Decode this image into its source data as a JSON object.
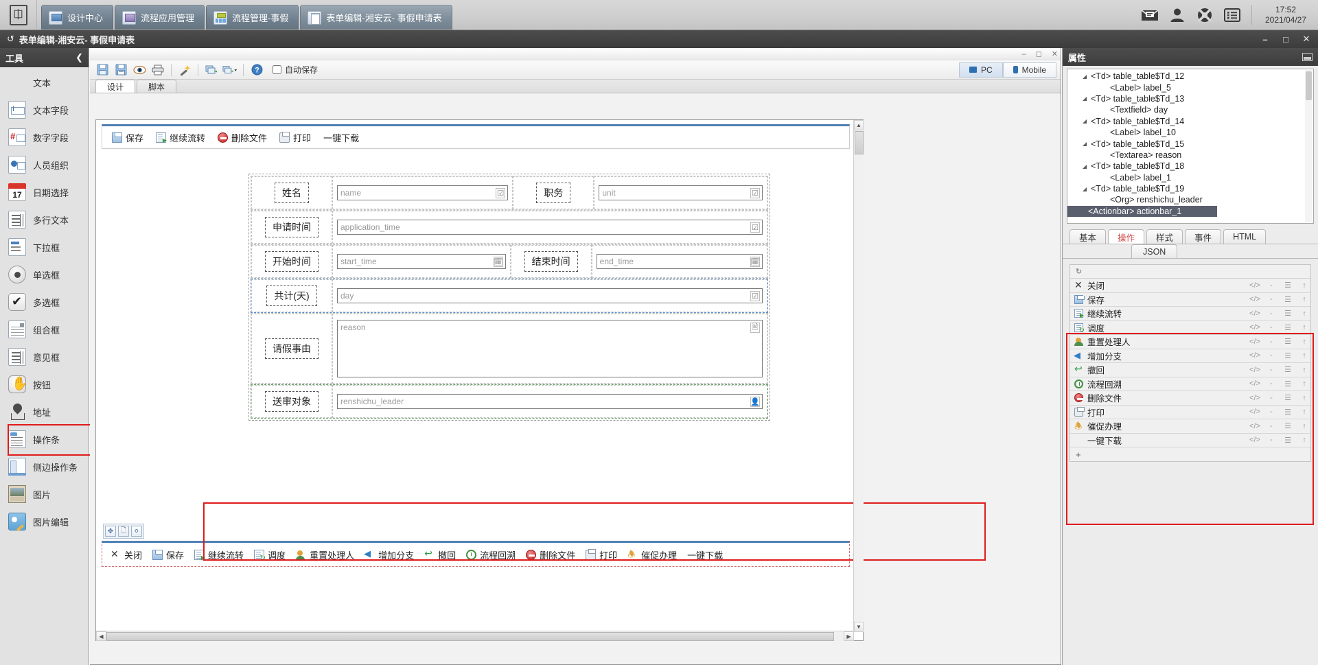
{
  "topbar": {
    "logo_icon": "app-logo-icon",
    "tabs": [
      {
        "label": "设计中心",
        "icon": "design-center-icon",
        "active": false
      },
      {
        "label": "流程应用管理",
        "icon": "flow-app-management-icon",
        "active": false
      },
      {
        "label": "流程管理-事假",
        "icon": "flow-management-icon",
        "active": false
      },
      {
        "label": "表单编辑-湘安云- 事假申请表",
        "icon": "form-editor-icon",
        "active": true
      }
    ],
    "icons": [
      "mail-icon",
      "user-icon",
      "support-icon",
      "list-icon"
    ],
    "time": "17:52",
    "date": "2021/04/27"
  },
  "window": {
    "title": "表单编辑-湘安云- 事假申请表",
    "refresh_icon": "refresh-icon",
    "minimize": "–",
    "maximize": "□",
    "close": "✕"
  },
  "sidebar": {
    "title": "工具",
    "collapse_icon": "❮",
    "items": [
      {
        "label": "文本",
        "icon": "text-icon",
        "shape": "ic-text"
      },
      {
        "label": "文本字段",
        "icon": "textfield-icon",
        "shape": "ic-box ic-textfield"
      },
      {
        "label": "数字字段",
        "icon": "number-field-icon",
        "shape": "ic-box ic-num"
      },
      {
        "label": "人员组织",
        "icon": "org-person-icon",
        "shape": "ic-box ic-org"
      },
      {
        "label": "日期选择",
        "icon": "date-picker-icon",
        "shape": "ic-date"
      },
      {
        "label": "多行文本",
        "icon": "multiline-text-icon",
        "shape": "ic-box ic-lines"
      },
      {
        "label": "下拉框",
        "icon": "dropdown-icon",
        "shape": "ic-box ic-select"
      },
      {
        "label": "单选框",
        "icon": "radio-button-icon",
        "shape": "ic-radio"
      },
      {
        "label": "多选框",
        "icon": "checkbox-icon",
        "shape": "ic-check"
      },
      {
        "label": "组合框",
        "icon": "combobox-icon",
        "shape": "ic-box ic-combo"
      },
      {
        "label": "意见框",
        "icon": "opinion-box-icon",
        "shape": "ic-box ic-lines"
      },
      {
        "label": "按钮",
        "icon": "button-icon",
        "shape": "ic-button"
      },
      {
        "label": "地址",
        "icon": "address-pin-icon",
        "shape": "ic-addr"
      },
      {
        "label": "操作条",
        "icon": "actionbar-icon",
        "shape": "ic-box ic-actionbar",
        "highlighted": true
      },
      {
        "label": "侧边操作条",
        "icon": "side-actionbar-icon",
        "shape": "ic-box ic-sideaction"
      },
      {
        "label": "图片",
        "icon": "image-icon",
        "shape": "ic-image"
      },
      {
        "label": "图片编辑",
        "icon": "image-edit-icon",
        "shape": "ic-imgedit"
      }
    ]
  },
  "editor": {
    "toolbar_icons": [
      "save-icon",
      "save-as-icon",
      "preview-eye-icon",
      "print-icon",
      "magic-wand-icon",
      "import-icon",
      "export-dropdown-icon",
      "help-icon"
    ],
    "autosave_label": "自动保存",
    "autosave_checked": false,
    "device_pc": "PC",
    "device_mobile": "Mobile",
    "device_selected": "PC",
    "tabs": [
      {
        "label": "设计",
        "active": true
      },
      {
        "label": "脚本",
        "active": false
      }
    ],
    "top_actionbar": [
      {
        "label": "保存",
        "icon": "save-icon",
        "shape": "ai-save"
      },
      {
        "label": "继续流转",
        "icon": "continue-flow-icon",
        "shape": "ai-flow"
      },
      {
        "label": "删除文件",
        "icon": "delete-file-icon",
        "shape": "ai-del"
      },
      {
        "label": "打印",
        "icon": "print-icon",
        "shape": "ai-print"
      },
      {
        "label": "一键下载",
        "icon": "none",
        "shape": "ai-none"
      }
    ],
    "bottom_actionbar": [
      {
        "label": "关闭",
        "icon": "close-icon",
        "shape": "ai-close"
      },
      {
        "label": "保存",
        "icon": "save-icon",
        "shape": "ai-save"
      },
      {
        "label": "继续流转",
        "icon": "continue-flow-icon",
        "shape": "ai-flow"
      },
      {
        "label": "调度",
        "icon": "dispatch-icon",
        "shape": "ai-dispatch"
      },
      {
        "label": "重置处理人",
        "icon": "reset-handler-icon",
        "shape": "ai-reset"
      },
      {
        "label": "增加分支",
        "icon": "add-branch-icon",
        "shape": "ai-branch"
      },
      {
        "label": "撤回",
        "icon": "withdraw-icon",
        "shape": "ai-undo"
      },
      {
        "label": "流程回溯",
        "icon": "flow-trace-icon",
        "shape": "ai-trace"
      },
      {
        "label": "删除文件",
        "icon": "delete-file-icon",
        "shape": "ai-del"
      },
      {
        "label": "打印",
        "icon": "print-icon",
        "shape": "ai-print"
      },
      {
        "label": "催促办理",
        "icon": "urge-icon",
        "shape": "ai-urge"
      },
      {
        "label": "一键下载",
        "icon": "none",
        "shape": "ai-none"
      }
    ],
    "form_rows": [
      {
        "cells": [
          {
            "label": "姓名",
            "value": "name",
            "field_icon": "select-field-icon",
            "width": "flex"
          },
          {
            "label": "职务",
            "value": "unit",
            "field_icon": "select-field-icon",
            "width": "flex"
          }
        ]
      },
      {
        "cells": [
          {
            "label": "申请时间",
            "value": "application_time",
            "field_icon": "select-field-icon",
            "width": "full"
          }
        ]
      },
      {
        "cells": [
          {
            "label": "开始时间",
            "value": "start_time",
            "field_icon": "calendar-icon",
            "width": "flex"
          },
          {
            "label": "结束时间",
            "value": "end_time",
            "field_icon": "calendar-icon",
            "width": "flex"
          }
        ]
      },
      {
        "selected": true,
        "cells": [
          {
            "label": "共计(天)",
            "value": "day",
            "field_icon": "select-field-icon",
            "width": "full"
          }
        ]
      },
      {
        "tall": true,
        "cells": [
          {
            "label": "请假事由",
            "value": "reason",
            "field_icon": "textarea-icon",
            "width": "full"
          }
        ]
      },
      {
        "green": true,
        "cells": [
          {
            "label": "送审对象",
            "value": "renshichu_leader",
            "field_icon": "person-picker-icon",
            "width": "full"
          }
        ]
      }
    ],
    "widget_handles": [
      "move-handle-icon",
      "copy-handle-icon",
      "delete-handle-icon"
    ]
  },
  "properties": {
    "title": "属性",
    "minimize_icon": "minimize-icon",
    "tree": [
      {
        "text": "<Td> table_table$Td_12",
        "level": 0,
        "expander": true
      },
      {
        "text": "<Label> label_5",
        "level": 1,
        "expander": false
      },
      {
        "text": "<Td> table_table$Td_13",
        "level": 0,
        "expander": true
      },
      {
        "text": "<Textfield> day",
        "level": 1,
        "expander": false
      },
      {
        "text": "<Td> table_table$Td_14",
        "level": 0,
        "expander": true
      },
      {
        "text": "<Label> label_10",
        "level": 1,
        "expander": false
      },
      {
        "text": "<Td> table_table$Td_15",
        "level": 0,
        "expander": true
      },
      {
        "text": "<Textarea> reason",
        "level": 1,
        "expander": false
      },
      {
        "text": "<Td> table_table$Td_18",
        "level": 0,
        "expander": true
      },
      {
        "text": "<Label> label_1",
        "level": 1,
        "expander": false
      },
      {
        "text": "<Td> table_table$Td_19",
        "level": 0,
        "expander": true
      },
      {
        "text": "<Org> renshichu_leader",
        "level": 1,
        "expander": false
      },
      {
        "text": "<Actionbar> actionbar_1",
        "level": 0,
        "expander": false,
        "selected": true
      }
    ],
    "tabs": [
      {
        "label": "基本",
        "active": false
      },
      {
        "label": "操作",
        "active": true
      },
      {
        "label": "样式",
        "active": false
      },
      {
        "label": "事件",
        "active": false
      },
      {
        "label": "HTML",
        "active": false
      }
    ],
    "subtabs": [
      {
        "label": "JSON",
        "active": false
      }
    ],
    "list_toolbar_icon": "history-icon",
    "action_items": [
      {
        "label": "关闭",
        "icon": "close-icon",
        "shape": "ai-close",
        "code": "</>",
        "dash": "-",
        "menu": "menu-icon",
        "up": "↑"
      },
      {
        "label": "保存",
        "icon": "save-icon",
        "shape": "ai-save",
        "code": "</>",
        "dash": "-",
        "menu": "menu-icon",
        "up": "↑"
      },
      {
        "label": "继续流转",
        "icon": "continue-flow-icon",
        "shape": "ai-flow",
        "code": "</>",
        "dash": "-",
        "menu": "menu-icon",
        "up": "↑"
      },
      {
        "label": "调度",
        "icon": "dispatch-icon",
        "shape": "ai-dispatch",
        "code": "</>",
        "dash": "-",
        "menu": "menu-icon",
        "up": "↑"
      },
      {
        "label": "重置处理人",
        "icon": "reset-handler-icon",
        "shape": "ai-reset",
        "code": "</>",
        "dash": "-",
        "menu": "menu-icon",
        "up": "↑"
      },
      {
        "label": "增加分支",
        "icon": "add-branch-icon",
        "shape": "ai-branch",
        "code": "</>",
        "dash": "-",
        "menu": "menu-icon",
        "up": "↑"
      },
      {
        "label": "撤回",
        "icon": "withdraw-icon",
        "shape": "ai-undo",
        "code": "</>",
        "dash": "-",
        "menu": "menu-icon",
        "up": "↑"
      },
      {
        "label": "流程回溯",
        "icon": "flow-trace-icon",
        "shape": "ai-trace",
        "code": "</>",
        "dash": "-",
        "menu": "menu-icon",
        "up": "↑"
      },
      {
        "label": "删除文件",
        "icon": "delete-file-icon",
        "shape": "ai-del",
        "code": "</>",
        "dash": "-",
        "menu": "menu-icon",
        "up": "↑"
      },
      {
        "label": "打印",
        "icon": "print-icon",
        "shape": "ai-print",
        "code": "</>",
        "dash": "-",
        "menu": "menu-icon",
        "up": "↑"
      },
      {
        "label": "催促办理",
        "icon": "urge-icon",
        "shape": "ai-urge",
        "code": "</>",
        "dash": "-",
        "menu": "menu-icon",
        "up": "↑"
      },
      {
        "label": "一键下载",
        "icon": "none",
        "shape": "ai-none",
        "code": "</>",
        "dash": "-",
        "menu": "menu-icon",
        "up": "↑"
      }
    ],
    "add_label": "+"
  },
  "colors": {
    "highlight_red": "#e01b1b",
    "accent_blue": "#4f7fb4",
    "tab_active_red": "#d04a4a",
    "titlebar_dark": "#3c3c3c"
  }
}
